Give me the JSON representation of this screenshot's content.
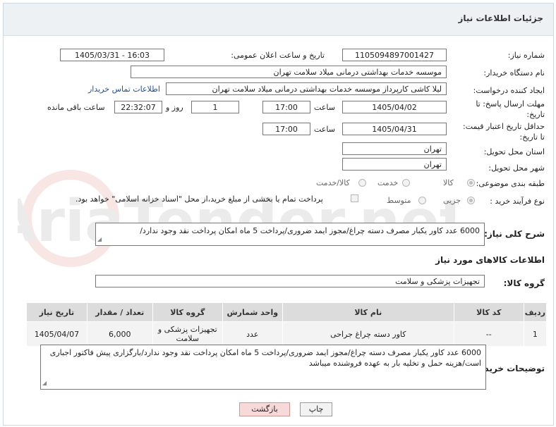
{
  "header": {
    "title": "جزئیات اطلاعات نیاز"
  },
  "labels": {
    "need_number": "شماره نیاز:",
    "announce_datetime": "تاریخ و ساعت اعلان عمومی:",
    "buyer_org": "نام دستگاه خریدار:",
    "requester": "ایجاد کننده درخواست:",
    "reply_deadline_1": "مهلت ارسال پاسخ: تا",
    "reply_deadline_2": "تاریخ:",
    "hour": "ساعت",
    "day_and": "روز و",
    "hours_left": "ساعت باقی مانده",
    "validity_1": "حداقل تاریخ اعتبار قیمت:",
    "validity_2": "تا تاریخ:",
    "province": "استان محل تحویل:",
    "city": "شهر محل تحویل:",
    "category": "طبقه بندی موضوعی:",
    "process": "نوع فرآیند خرید :",
    "overall_desc": "شرح کلی نیاز:",
    "goods_info": "اطلاعات کالاهای مورد نیاز",
    "goods_group": "گروه کالا:",
    "buyer_notes": "توضیحات خریدار:"
  },
  "fields": {
    "need_number": "1105094897001427",
    "announce_datetime": "1405/03/31 - 16:03",
    "buyer_org": "موسسه خدمات بهداشتی درمانی میلاد سلامت تهران",
    "requester": "لیلا کاشی کارپرداز موسسه خدمات بهداشتی درمانی میلاد سلامت تهران",
    "contact_link": "اطلاعات تماس خریدار",
    "reply_date": "1405/04/02",
    "reply_time": "17:00",
    "days_left": "1",
    "time_left": "22:32:07",
    "validity_date": "1405/04/31",
    "validity_time": "17:00",
    "province": "تهران",
    "city": "تهران",
    "overall_desc": "6000  عدد کاور یکبار مصرف دسته چراغ/مجوز ایمد ضروری/پرداخت 5 ماه امکان پرداخت نقد وجود ندارد/",
    "goods_group": "تجهیزات پزشکی و سلامت",
    "buyer_notes": "6000  عدد کاور یکبار مصرف دسته چراغ/مجوز ایمد ضروری/پرداخت 5 ماه امکان پرداخت نقد وجود ندارد/بارگزاری پیش فاکتور اجباری است/هزینه حمل و تخلیه بار به عهده فروشنده میباشد"
  },
  "category_options": {
    "goods": "کالا",
    "service": "خدمت",
    "goods_service": "کالا/خدمت",
    "selected": "goods"
  },
  "process_options": {
    "partial": "جزیی",
    "medium": "متوسط",
    "treasury_note": "پرداخت تمام یا بخشی از مبلغ خرید،از محل \"اسناد خزانه اسلامی\" خواهد بود.",
    "selected": "partial"
  },
  "table": {
    "headers": [
      "ردیف",
      "کد کالا",
      "نام کالا",
      "واحد شمارش",
      "گروه کالا",
      "تعداد / مقدار",
      "تاریخ نیاز"
    ],
    "rows": [
      [
        "1",
        "--",
        "کاور دسته چراغ جراحی",
        "عدد",
        "تجهیزات پزشکی و سلامت",
        "6,000",
        "1405/04/07"
      ]
    ]
  },
  "buttons": {
    "print": "چاپ",
    "back": "بازگشت"
  },
  "watermark": {
    "text": "AriaTender.net"
  },
  "colors": {
    "header_bg": "#eef1f4",
    "back_button_bg": "#f7d9d9",
    "print_button_bg": "#f2f2f2",
    "link": "#1a4f9c"
  }
}
